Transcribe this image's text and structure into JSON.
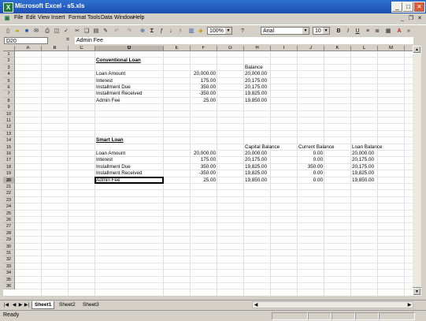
{
  "window": {
    "title": "Microsoft Excel - s5.xls",
    "app_icon": "X"
  },
  "menubar": {
    "items": [
      "File",
      "Edit",
      "View",
      "Insert",
      "Format",
      "Tools",
      "Data",
      "Window",
      "Help"
    ]
  },
  "toolbar": {
    "zoom": "100%",
    "font_name": "Arial",
    "font_size": "10",
    "bold": "B",
    "italic": "I",
    "underline": "U"
  },
  "formula_bar": {
    "name_box": "D20",
    "equals": "=",
    "content": "Admin Fee"
  },
  "grid": {
    "columns": [
      "A",
      "B",
      "C",
      "D",
      "E",
      "F",
      "G",
      "H",
      "I",
      "J",
      "K",
      "L",
      "M",
      "N"
    ],
    "rows": [
      "1",
      "2",
      "3",
      "4",
      "5",
      "6",
      "7",
      "8",
      "9",
      "10",
      "11",
      "12",
      "13",
      "14",
      "15",
      "16",
      "17",
      "18",
      "19",
      "20",
      "21",
      "22",
      "23",
      "24",
      "25",
      "26",
      "27",
      "28",
      "29",
      "30",
      "31",
      "32",
      "33",
      "34",
      "35",
      "36"
    ],
    "selected_cell": "D20",
    "cells": [
      {
        "ref": "D2",
        "value": "Conventional Loan",
        "style": "bu"
      },
      {
        "ref": "H3",
        "value": "Balance"
      },
      {
        "ref": "D4",
        "value": "Loan Amount"
      },
      {
        "ref": "F4",
        "value": "20,000.00",
        "align": "r"
      },
      {
        "ref": "H4",
        "value": "20,000.00"
      },
      {
        "ref": "D5",
        "value": "Interest"
      },
      {
        "ref": "F5",
        "value": "175.00",
        "align": "r"
      },
      {
        "ref": "H5",
        "value": "20,175.00"
      },
      {
        "ref": "D6",
        "value": "Installment Due"
      },
      {
        "ref": "F6",
        "value": "350.00",
        "align": "r"
      },
      {
        "ref": "H6",
        "value": "20,175.00"
      },
      {
        "ref": "D7",
        "value": "Installment Received"
      },
      {
        "ref": "F7",
        "value": "-350.00",
        "align": "r"
      },
      {
        "ref": "H7",
        "value": "19,825.00"
      },
      {
        "ref": "D8",
        "value": "Admin Fee"
      },
      {
        "ref": "F8",
        "value": "25.00",
        "align": "r"
      },
      {
        "ref": "H8",
        "value": "19,850.00"
      },
      {
        "ref": "D14",
        "value": "Smart Loan",
        "style": "bu"
      },
      {
        "ref": "H15",
        "value": "Capital Balance"
      },
      {
        "ref": "J15",
        "value": "Current Balance"
      },
      {
        "ref": "L15",
        "value": "Loan Balance"
      },
      {
        "ref": "D16",
        "value": "Loan Amount"
      },
      {
        "ref": "F16",
        "value": "20,000.00",
        "align": "r"
      },
      {
        "ref": "H16",
        "value": "20,000.00"
      },
      {
        "ref": "J16",
        "value": "0.00",
        "align": "r"
      },
      {
        "ref": "L16",
        "value": "20,000.00"
      },
      {
        "ref": "D17",
        "value": "Interest"
      },
      {
        "ref": "F17",
        "value": "175.00",
        "align": "r"
      },
      {
        "ref": "H17",
        "value": "20,175.00"
      },
      {
        "ref": "J17",
        "value": "0.00",
        "align": "r"
      },
      {
        "ref": "L17",
        "value": "20,175.00"
      },
      {
        "ref": "D18",
        "value": "Installment Due"
      },
      {
        "ref": "F18",
        "value": "350.00",
        "align": "r"
      },
      {
        "ref": "H18",
        "value": "19,825.00"
      },
      {
        "ref": "J18",
        "value": "350.00",
        "align": "r"
      },
      {
        "ref": "L18",
        "value": "20,175.00"
      },
      {
        "ref": "D19",
        "value": "Installment Received"
      },
      {
        "ref": "F19",
        "value": "-350.00",
        "align": "r"
      },
      {
        "ref": "H19",
        "value": "19,825.00"
      },
      {
        "ref": "J19",
        "value": "0.00",
        "align": "r"
      },
      {
        "ref": "L19",
        "value": "19,825.00"
      },
      {
        "ref": "D20",
        "value": "Admin Fee"
      },
      {
        "ref": "F20",
        "value": "25.00",
        "align": "r"
      },
      {
        "ref": "H20",
        "value": "19,850.00"
      },
      {
        "ref": "J20",
        "value": "0.00",
        "align": "r"
      },
      {
        "ref": "L20",
        "value": "19,850.00"
      }
    ]
  },
  "sheet_tabs": [
    "Sheet1",
    "Sheet2",
    "Sheet3"
  ],
  "active_sheet": "Sheet1",
  "status": {
    "text": "Ready"
  }
}
